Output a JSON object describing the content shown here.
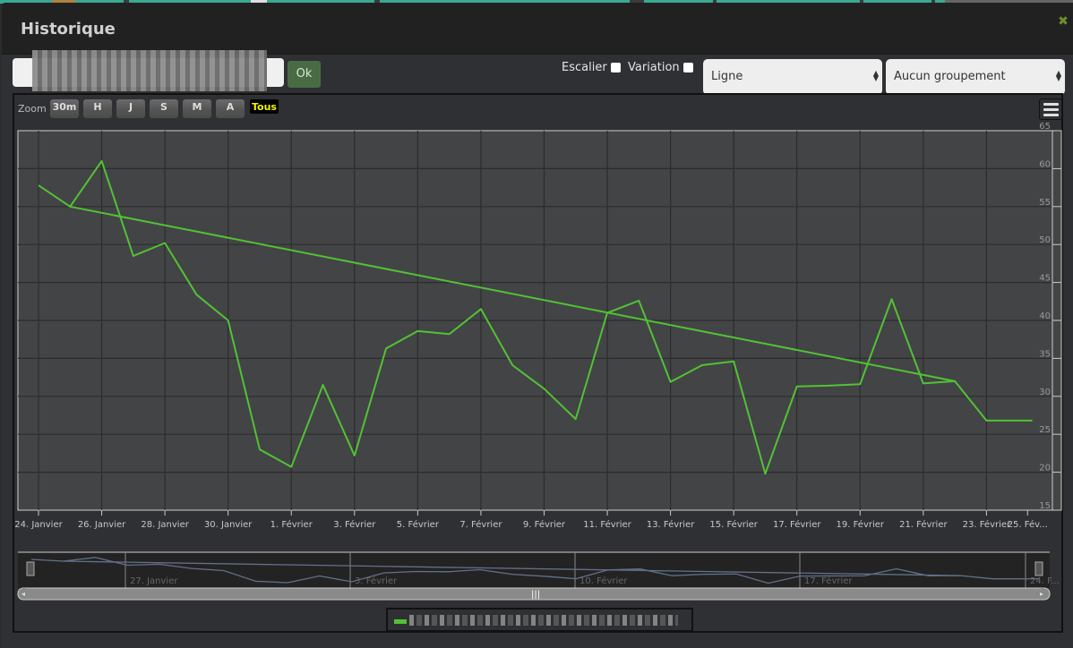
{
  "dialog": {
    "title": "Historique",
    "close_icon": "close-x-icon",
    "accent_color": "#52c234"
  },
  "toolbar": {
    "search_value": "",
    "ok_label": "Ok",
    "escalier_label": "Escalier",
    "escalier_checked": false,
    "variation_label": "Variation",
    "variation_checked": false,
    "chart_type_selected": "Ligne",
    "grouping_selected": "Aucun groupement"
  },
  "range_selector": {
    "label": "Zoom",
    "buttons": [
      "30m",
      "H",
      "J",
      "S",
      "M",
      "A"
    ],
    "active": "Tous"
  },
  "menu_icon": "hamburger-menu-icon",
  "chart_data": {
    "type": "line",
    "title": "",
    "xlabel": "",
    "ylabel": "",
    "ylim": [
      15,
      65
    ],
    "yticks": [
      15,
      20,
      25,
      30,
      35,
      40,
      45,
      50,
      55,
      60,
      65
    ],
    "y_axis_side": "right",
    "grid": true,
    "x_start": "24. Janvier",
    "x_end": "25. Février",
    "xticks": [
      "24. Janvier",
      "26. Janvier",
      "28. Janvier",
      "30. Janvier",
      "1. Février",
      "3. Février",
      "5. Février",
      "7. Février",
      "9. Février",
      "11. Février",
      "13. Février",
      "15. Février",
      "17. Février",
      "19. Février",
      "21. Février",
      "23. Février",
      "25. Fév..."
    ],
    "series": [
      {
        "name": "(masked)",
        "color": "#52c234",
        "x_days": [
          0,
          1,
          2,
          3,
          4,
          5,
          6,
          7,
          8,
          9,
          10,
          11,
          12,
          13,
          14,
          15,
          16,
          17,
          18,
          19,
          20,
          21,
          22,
          23,
          24,
          25,
          26,
          27,
          28,
          29,
          30,
          31.45
        ],
        "values": [
          57.8,
          55.0,
          61.0,
          48.5,
          50.2,
          43.4,
          40.0,
          23.0,
          20.7,
          31.5,
          22.2,
          36.3,
          38.6,
          38.2,
          41.5,
          34.1,
          31.0,
          27.0,
          41.0,
          42.6,
          31.9,
          34.1,
          34.6,
          19.8,
          31.3,
          31.4,
          31.6,
          42.8,
          31.7,
          32.0,
          26.8,
          26.8
        ],
        "extra_segment": {
          "from_day": 1,
          "from_value": 55.0,
          "to_day": 29,
          "to_value": 32.0
        }
      }
    ],
    "legend": {
      "position": "bottom-center",
      "entries": [
        "(masked)"
      ]
    },
    "navigator": {
      "labels": [
        "27. Janvier",
        "3. Février",
        "10. Février",
        "17. Février",
        "24. F..."
      ]
    }
  }
}
